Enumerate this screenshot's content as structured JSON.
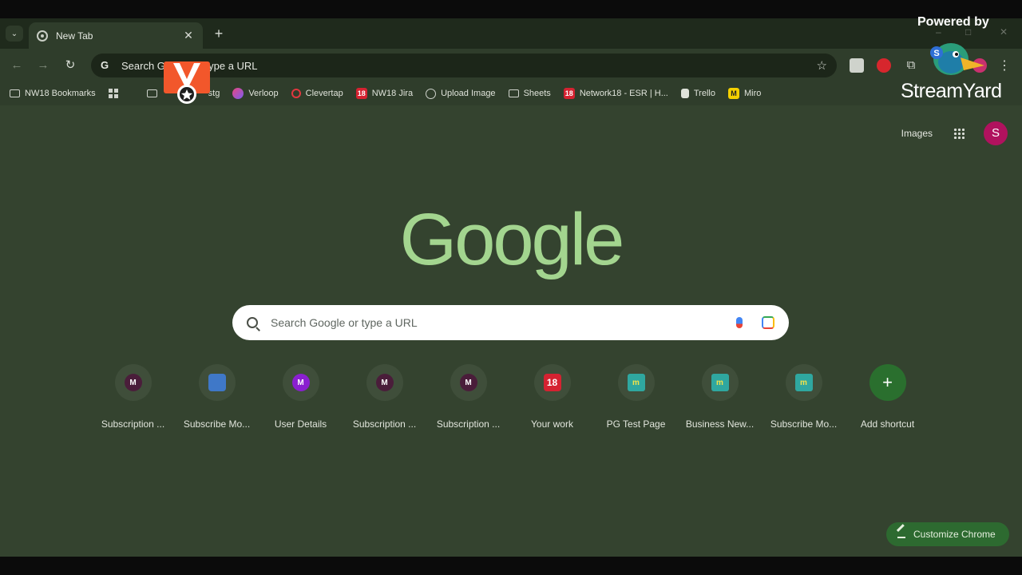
{
  "tab": {
    "title": "New Tab",
    "close_glyph": "✕",
    "new_tab_glyph": "+",
    "list_glyph": "⌄"
  },
  "omnibox": {
    "text": "Search Google or type a URL",
    "icon": "G",
    "star": "☆"
  },
  "nav": {
    "back": "←",
    "forward": "→",
    "reload": "↻",
    "menu": "⋮",
    "extensions": "⧉"
  },
  "bookmarks": [
    {
      "label": "NW18 Bookmarks",
      "icon": "folder-icon"
    },
    {
      "label": "",
      "icon": "apps-grid-icon"
    },
    {
      "label": "stg",
      "icon": "folder-icon"
    },
    {
      "label": "Verloop",
      "icon": "verloop-icon"
    },
    {
      "label": "Clevertap",
      "icon": "clevertap-icon"
    },
    {
      "label": "NW18 Jira",
      "icon": "network18-icon",
      "badge": "18"
    },
    {
      "label": "Upload Image",
      "icon": "globe-icon"
    },
    {
      "label": "Sheets",
      "icon": "folder-icon"
    },
    {
      "label": "Network18 - ESR | H...",
      "icon": "network18-icon",
      "badge": "18"
    },
    {
      "label": "Trello",
      "icon": "trello-icon"
    },
    {
      "label": "Miro",
      "icon": "miro-icon",
      "badge": "M"
    }
  ],
  "header": {
    "images_label": "Images",
    "avatar_letter": "S"
  },
  "logo": "Google",
  "search": {
    "placeholder": "Search Google or type a URL"
  },
  "shortcuts": [
    {
      "label": "Subscription ...",
      "badge": "M",
      "style": "m-dark"
    },
    {
      "label": "Subscribe Mo...",
      "badge": "",
      "style": "sub"
    },
    {
      "label": "User Details",
      "badge": "M",
      "style": "m-purple"
    },
    {
      "label": "Subscription ...",
      "badge": "M",
      "style": "m-dark"
    },
    {
      "label": "Subscription ...",
      "badge": "M",
      "style": "m-dark"
    },
    {
      "label": "Your work",
      "badge": "18",
      "style": "18b"
    },
    {
      "label": "PG Test Page",
      "badge": "m",
      "style": "mm"
    },
    {
      "label": "Business New...",
      "badge": "m",
      "style": "mm"
    },
    {
      "label": "Subscribe Mo...",
      "badge": "m",
      "style": "mm"
    },
    {
      "label": "Add shortcut",
      "badge": "+",
      "style": "plus"
    }
  ],
  "customize": {
    "label": "Customize Chrome"
  },
  "overlay": {
    "powered_by": "Powered by",
    "brand": "StreamYard",
    "mascot_badge": "S"
  },
  "window": {
    "minimize": "–",
    "maximize": "□",
    "close": "✕"
  }
}
